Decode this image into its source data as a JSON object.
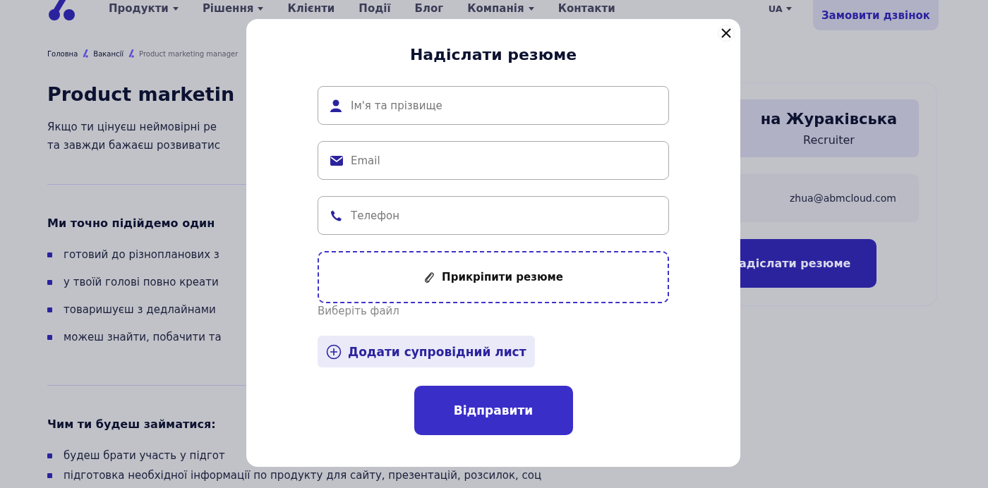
{
  "header": {
    "nav": [
      {
        "label": "Продукти",
        "dropdown": true
      },
      {
        "label": "Рішення",
        "dropdown": true
      },
      {
        "label": "Клієнти",
        "dropdown": false
      },
      {
        "label": "Події",
        "dropdown": false
      },
      {
        "label": "Блог",
        "dropdown": false
      },
      {
        "label": "Компанія",
        "dropdown": true
      },
      {
        "label": "Контакти",
        "dropdown": false
      }
    ],
    "language": "UA",
    "call_button": "Замовити дзвінок"
  },
  "breadcrumbs": [
    {
      "label": "Головна",
      "current": false
    },
    {
      "label": "Вакансії",
      "current": false
    },
    {
      "label": "Product marketing manager",
      "current": true
    }
  ],
  "vacancy": {
    "title": "Product marketin",
    "intro": [
      "Якщо ти цінуєш неймовірні ре",
      "та завжди бажаєш розвиватис"
    ],
    "sections": [
      {
        "heading": "Ми точно підійдемо один",
        "items": [
          "готовий до різнопланових з",
          "у твоїй голові повно креати",
          "товаришуєш з дедлайнами",
          "можеш знайти, побачити та"
        ]
      },
      {
        "heading": "Чим ти будеш займатися:",
        "items": [
          "будеш брати участь у підгот",
          "підготовка необхідної інформації по продукту для сайту, презентацій, розсилок, соц"
        ]
      }
    ]
  },
  "recruiter": {
    "name": "на Жураківська",
    "role": "Recruiter",
    "email": "zhua@abmcloud.com",
    "button": "адіслати резюме"
  },
  "modal": {
    "title": "Надіслати резюме",
    "fields": [
      {
        "kind": "name",
        "placeholder": "Ім'я та прізвище"
      },
      {
        "kind": "email",
        "placeholder": "Email"
      },
      {
        "kind": "phone",
        "placeholder": "Телефон"
      }
    ],
    "attach": {
      "label": "Прикріпити резюме",
      "hint": "Виберіть файл"
    },
    "cover_letter": "Додати супровідний лист",
    "submit": "Відправити"
  }
}
